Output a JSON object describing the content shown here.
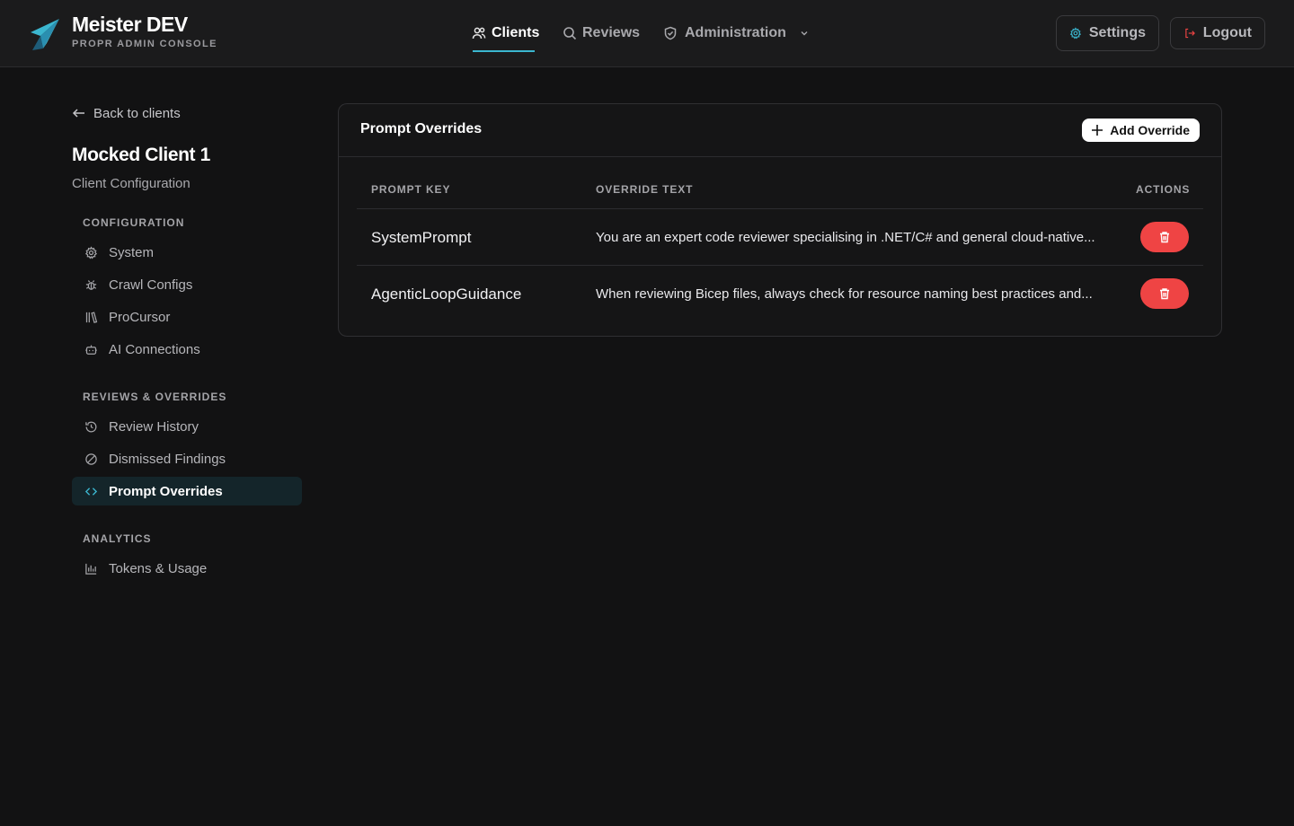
{
  "header": {
    "brand_title": "Meister DEV",
    "brand_subtitle": "PROPR ADMIN CONSOLE",
    "nav": [
      {
        "label": "Clients",
        "icon": "users-icon",
        "active": true
      },
      {
        "label": "Reviews",
        "icon": "search-icon",
        "active": false
      },
      {
        "label": "Administration",
        "icon": "shield-icon",
        "active": false
      }
    ],
    "settings_label": "Settings",
    "logout_label": "Logout"
  },
  "sidebar": {
    "back_label": "Back to clients",
    "client_name": "Mocked Client 1",
    "client_subtitle": "Client Configuration",
    "sections": [
      {
        "title": "CONFIGURATION",
        "items": [
          {
            "label": "System",
            "icon": "gear-icon"
          },
          {
            "label": "Crawl Configs",
            "icon": "bug-icon"
          },
          {
            "label": "ProCursor",
            "icon": "library-icon"
          },
          {
            "label": "AI Connections",
            "icon": "bot-icon"
          }
        ]
      },
      {
        "title": "REVIEWS & OVERRIDES",
        "items": [
          {
            "label": "Review History",
            "icon": "history-icon"
          },
          {
            "label": "Dismissed Findings",
            "icon": "ban-icon"
          },
          {
            "label": "Prompt Overrides",
            "icon": "code-icon",
            "active": true
          }
        ]
      },
      {
        "title": "ANALYTICS",
        "items": [
          {
            "label": "Tokens & Usage",
            "icon": "chart-icon"
          }
        ]
      }
    ]
  },
  "main": {
    "card_title": "Prompt Overrides",
    "add_label": "Add Override",
    "columns": {
      "key": "PROMPT KEY",
      "text": "OVERRIDE TEXT",
      "actions": "ACTIONS"
    },
    "rows": [
      {
        "key": "SystemPrompt",
        "text": "You are an expert code reviewer specialising in .NET/C# and general cloud-native..."
      },
      {
        "key": "AgenticLoopGuidance",
        "text": "When reviewing Bicep files, always check for resource naming best practices and..."
      }
    ]
  },
  "colors": {
    "accent": "#3bb6cf",
    "danger": "#ef4444",
    "logout_icon": "#ef4444",
    "background": "#121213"
  }
}
